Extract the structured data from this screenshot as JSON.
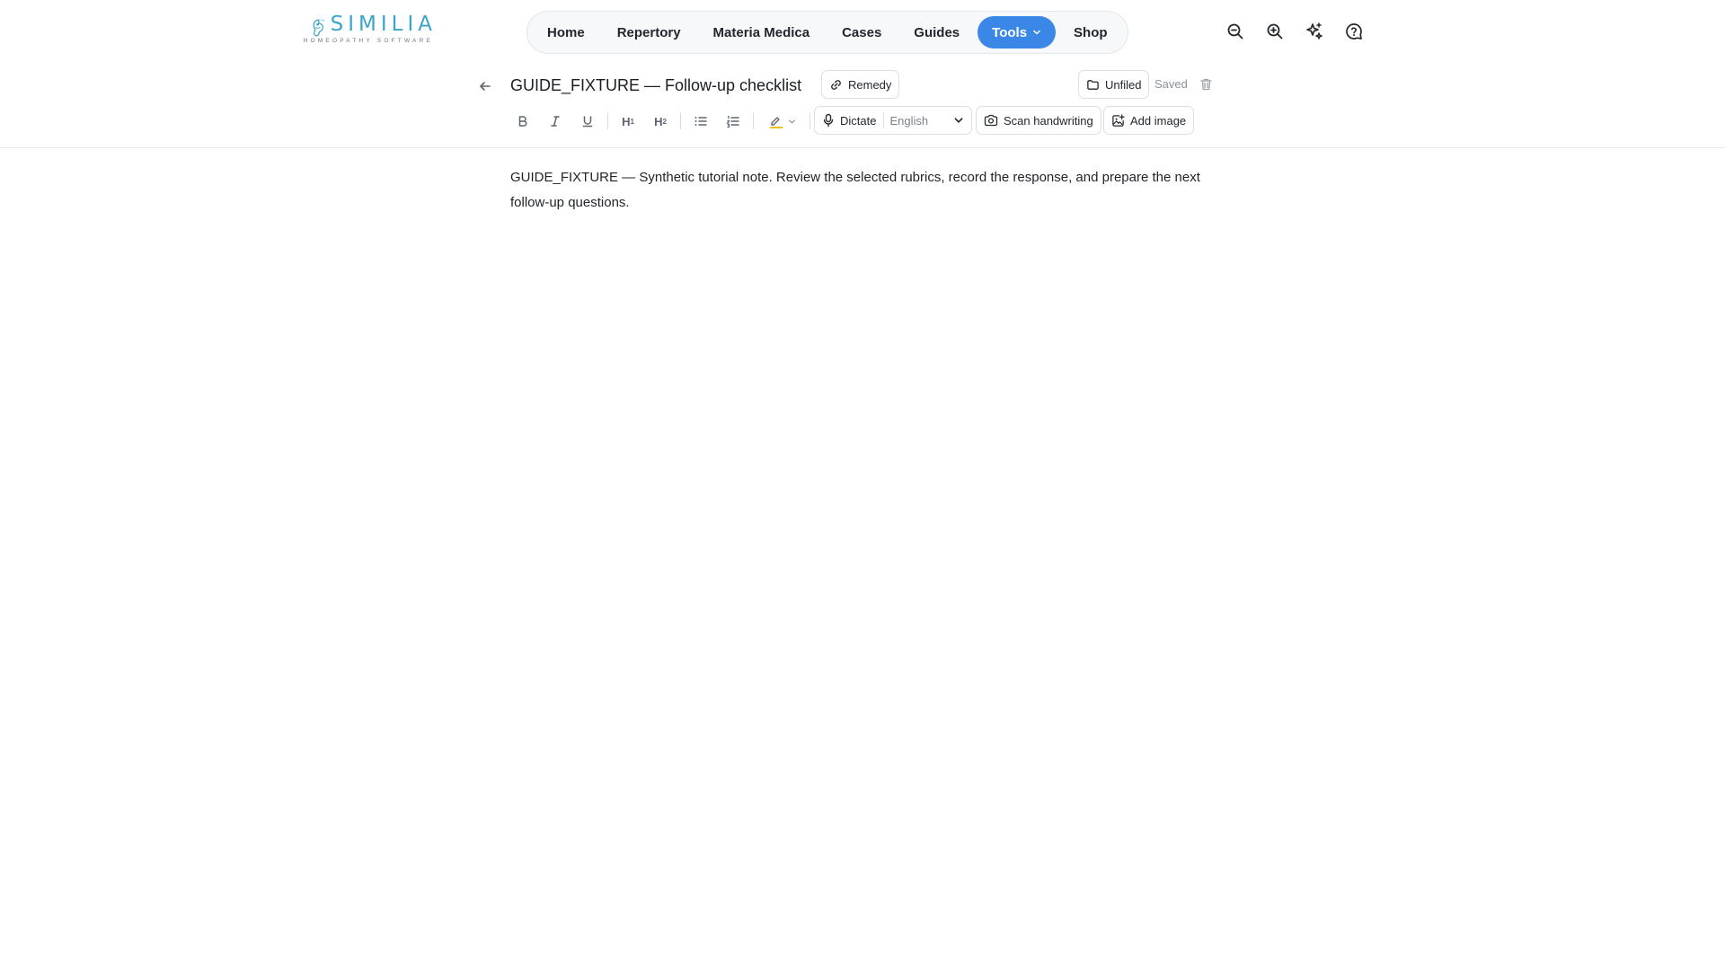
{
  "brand": {
    "name": "SIMILIA",
    "tagline": "HOMEOPATHY SOFTWARE",
    "accent": "#3aa5c9"
  },
  "nav": {
    "items": [
      {
        "label": "Home"
      },
      {
        "label": "Repertory"
      },
      {
        "label": "Materia Medica"
      },
      {
        "label": "Cases"
      },
      {
        "label": "Guides"
      },
      {
        "label": "Tools",
        "active": true
      },
      {
        "label": "Shop"
      }
    ],
    "active_color": "#3b87e8"
  },
  "top_icons": [
    "zoom-out-icon",
    "zoom-in-icon",
    "sparkles-icon",
    "help-icon"
  ],
  "note": {
    "title": "GUIDE_FIXTURE — Follow-up checklist",
    "remedy_label": "Remedy",
    "folder_label": "Unfiled",
    "status": "Saved",
    "body": "GUIDE_FIXTURE — Synthetic tutorial note. Review the selected rubrics, record the response, and prepare the next follow-up questions."
  },
  "toolbar": {
    "h1_label": "H",
    "h1_sub": "1",
    "h2_label": "H",
    "h2_sub": "2",
    "dictate_label": "Dictate",
    "language": "English",
    "scan_label": "Scan handwriting",
    "add_image_label": "Add image",
    "highlight_color": "#e8c21b"
  }
}
